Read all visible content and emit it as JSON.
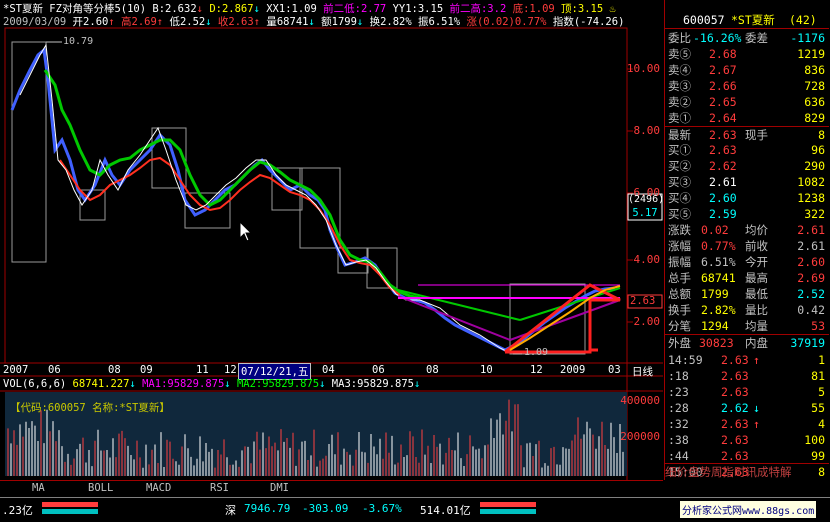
{
  "header": {
    "name": "*ST夏新",
    "indicator": "FZ对角等分棒5(10)",
    "b": "B:2.632",
    "b_arrow": "↓",
    "d": "D:2.867",
    "d_arrow": "↓",
    "xx1": "XX1:1.09",
    "prev2low": "前二低:2.77",
    "yy1": "YY1:3.15",
    "prev2high": "前二高:3.2",
    "bottom": "底:1.09",
    "top": "顶:3.15",
    "alarm": "♨"
  },
  "quote_line": {
    "date": "2009/03/09",
    "open": "开2.60",
    "open_arrow": "↑",
    "high": "高2.69",
    "high_arrow": "↑",
    "low": "低2.52",
    "low_arrow": "↓",
    "close": "收2.63",
    "close_arrow": "↑",
    "volume": "量68741",
    "vol_arrow": "↓",
    "amount": "额1799",
    "amt_arrow": "↓",
    "turnover": "换2.82%",
    "amplitude": "振6.51%",
    "change": "涨(0.02)0.77%",
    "index": "指数(-74.26)"
  },
  "price_axis": [
    "10.00",
    "8.00",
    "6.00",
    "4.00",
    "2.00"
  ],
  "price_box": {
    "top": "(2496)",
    "bottom": "5.17"
  },
  "peak_label": "10.79",
  "low_label": "1.09",
  "current_price_tag": "2.63",
  "time_axis": [
    "2007",
    "06",
    "08",
    "09",
    "11",
    "12",
    "07/12/21,五",
    "04",
    "06",
    "08",
    "10",
    "12",
    "2009",
    "03"
  ],
  "period_label": "日线",
  "vol_line": {
    "name": "VOL(6,6,6)",
    "value": "68741.227",
    "v_arrow": "↓",
    "ma1": "MA1:95829.875",
    "ma1_arrow": "↓",
    "ma2": "MA2:95829.875",
    "ma2_arrow": "↓",
    "ma3": "MA3:95829.875",
    "ma3_arrow": "↓"
  },
  "vol_info": "【代码:600057 名称:*ST夏新】",
  "vol_axis": [
    "400000",
    "200000"
  ],
  "tabs": [
    "MA",
    "BOLL",
    "MACD",
    "RSI",
    "DMI"
  ],
  "right_panel": {
    "code": "600057",
    "name": "*ST夏新",
    "count": "(42)",
    "weibi_label": "委比",
    "weibi": "-16.26%",
    "weicha_label": "委差",
    "weicha": "-1176",
    "sell": [
      {
        "label": "卖⑤",
        "price": "2.68",
        "vol": "1219"
      },
      {
        "label": "卖④",
        "price": "2.67",
        "vol": "836"
      },
      {
        "label": "卖③",
        "price": "2.66",
        "vol": "728"
      },
      {
        "label": "卖②",
        "price": "2.65",
        "vol": "636"
      },
      {
        "label": "卖①",
        "price": "2.64",
        "vol": "829"
      }
    ],
    "latest_label": "最新",
    "latest": "2.63",
    "current_label": "现手",
    "current": "8",
    "buy": [
      {
        "label": "买①",
        "price": "2.63",
        "vol": "96"
      },
      {
        "label": "买②",
        "price": "2.62",
        "vol": "290"
      },
      {
        "label": "买③",
        "price": "2.61",
        "vol": "1082"
      },
      {
        "label": "买④",
        "price": "2.60",
        "vol": "1238"
      },
      {
        "label": "买⑤",
        "price": "2.59",
        "vol": "322"
      }
    ],
    "stats": [
      {
        "l1": "涨跌",
        "v1": "0.02",
        "l2": "均价",
        "v2": "2.61"
      },
      {
        "l1": "涨幅",
        "v1": "0.77%",
        "l2": "前收",
        "v2": "2.61"
      },
      {
        "l1": "振幅",
        "v1": "6.51%",
        "l2": "今开",
        "v2": "2.60"
      },
      {
        "l1": "总手",
        "v1": "68741",
        "l2": "最高",
        "v2": "2.69"
      },
      {
        "l1": "总额",
        "v1": "1799",
        "l2": "最低",
        "v2": "2.52"
      },
      {
        "l1": "换手",
        "v1": "2.82%",
        "l2": "量比",
        "v2": "0.42"
      },
      {
        "l1": "分笔",
        "v1": "1294",
        "l2": "均量",
        "v2": "53"
      }
    ],
    "outer_label": "外盘",
    "outer": "30823",
    "inner_label": "内盘",
    "inner": "37919",
    "ticks": [
      {
        "time": "14:59",
        "price": "2.63",
        "arrow": "↑",
        "vol": "1"
      },
      {
        "time": ":18",
        "price": "2.63",
        "arrow": "",
        "vol": "81"
      },
      {
        "time": ":23",
        "price": "2.63",
        "arrow": "",
        "vol": "5"
      },
      {
        "time": ":28",
        "price": "2.62",
        "arrow": "↓",
        "vol": "55"
      },
      {
        "time": ":32",
        "price": "2.63",
        "arrow": "↑",
        "vol": "4"
      },
      {
        "time": ":38",
        "price": "2.63",
        "arrow": "",
        "vol": "100"
      },
      {
        "time": ":44",
        "price": "2.63",
        "arrow": "",
        "vol": "99"
      },
      {
        "time": "15:00",
        "price": "2.63",
        "arrow": "",
        "vol": "8"
      }
    ],
    "footer": "细价盘势周指时讯成特解"
  },
  "status": {
    "left_value": ".23亿",
    "market": "深",
    "index": "7946.79",
    "change": "-303.09",
    "pct": "-3.67%",
    "amount": "514.01亿",
    "site": "分析家公式网www.88gs.com"
  },
  "colors": {
    "up": "#ff3c3c",
    "down": "#00ffff",
    "frame": "#a00000"
  }
}
